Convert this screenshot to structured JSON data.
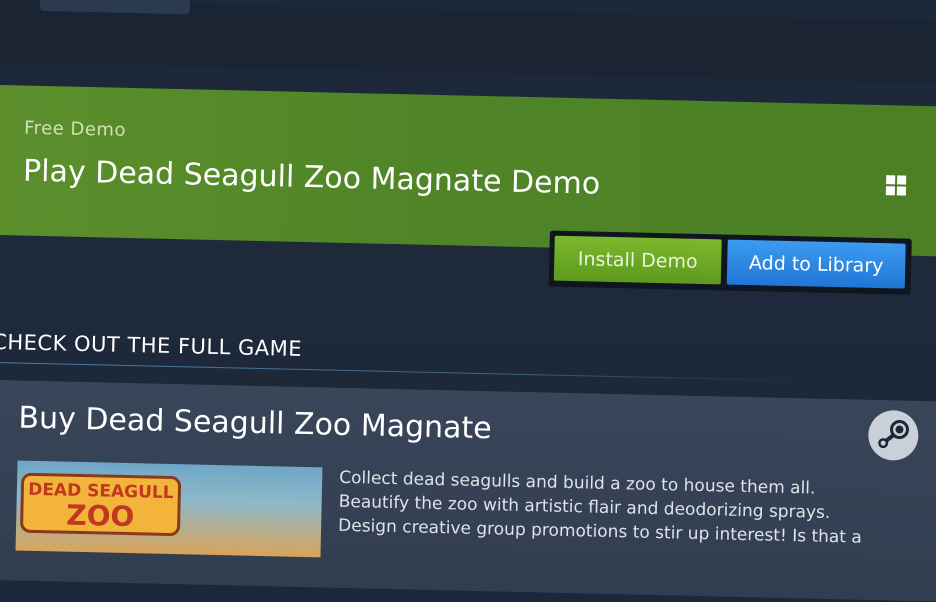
{
  "demo": {
    "eyebrow": "Free Demo",
    "title": "Play Dead Seagull Zoo Magnate Demo",
    "platform_icon": "windows-icon",
    "install_label": "Install Demo",
    "library_label": "Add to Library"
  },
  "section": {
    "title": "CHECK OUT THE FULL GAME"
  },
  "purchase": {
    "title": "Buy Dead Seagull Zoo Magnate",
    "store_icon": "steam-icon",
    "logo_line1": "DEAD SEAGULL",
    "logo_line2": "ZOO",
    "description": [
      "Collect dead seagulls and build a zoo to house them all.",
      "Beautify the zoo with artistic flair and deodorizing sprays.",
      "Design creative group promotions to stir up interest! Is that a"
    ]
  },
  "colors": {
    "demo_panel": "#4f8527",
    "install_button": "#6aaa24",
    "library_button": "#2d86e3",
    "page_background": "#1b2838"
  }
}
